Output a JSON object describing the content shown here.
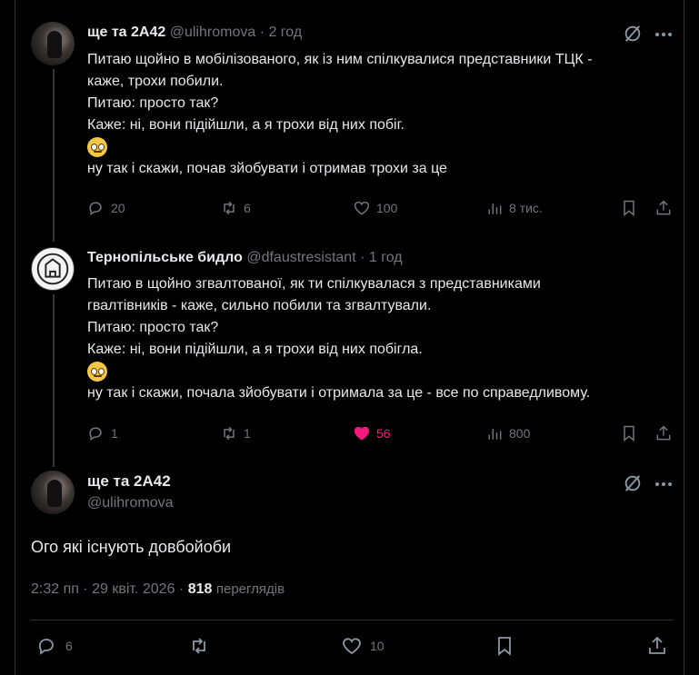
{
  "tweet1": {
    "name": "ще та 2А42",
    "handle": "@ulihromova",
    "time": "· 2 год",
    "lines": [
      "Питаю щойно в мобілізованого, як із ним спілкувалися представники ТЦК -",
      "каже, трохи побили.",
      "Питаю: просто так?",
      "Каже: ні, вони підійшли, а я трохи від них побіг.",
      "ну так і скажи, почав зйобувати і отримав трохи за це"
    ],
    "replies": "20",
    "reposts": "6",
    "likes": "100",
    "views": "8 тис."
  },
  "tweet2": {
    "name": "Тернопільське бидло",
    "handle": "@dfaustresistant",
    "time": "· 1 год",
    "lines": [
      "Питаю в щойно згвалтованої, як ти  спілкувалася з представниками",
      "гвалтівників - каже, сильно побили та згвалтували.",
      "Питаю: просто так?",
      "Каже: ні, вони підійшли, а я трохи від них побігла.",
      "ну так і скажи, почала зйобувати і отримала  за це - все по справедливому."
    ],
    "replies": "1",
    "reposts": "1",
    "likes": "56",
    "views": "800"
  },
  "main": {
    "name": "ще та 2А42",
    "handle": "@ulihromova",
    "text": "Ого які існують довбойоби",
    "datetime": "2:32 пп · 29 квіт. 2026 ·",
    "views_count": "818",
    "views_label": "переглядів",
    "replies": "6",
    "likes": "10"
  },
  "colors": {
    "like": "#f91880",
    "muted": "#71767b",
    "border": "#2f3336"
  },
  "icons": [
    "reply-icon",
    "repost-icon",
    "like-icon",
    "views-icon",
    "bookmark-icon",
    "share-icon",
    "grok-icon",
    "more-icon"
  ]
}
